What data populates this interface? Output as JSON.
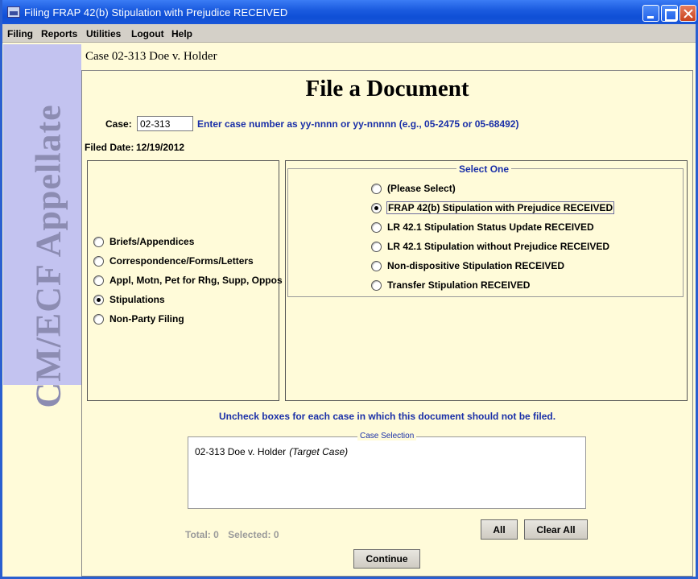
{
  "window": {
    "title": "Filing FRAP 42(b) Stipulation with Prejudice RECEIVED"
  },
  "menu": [
    "Filing",
    "Reports",
    "Utilities",
    "Logout",
    "Help"
  ],
  "sidebar": {
    "logo_text": "CM/ECF Appellate"
  },
  "case_header": "Case 02-313 Doe v. Holder",
  "page_title": "File a Document",
  "case_field": {
    "label": "Case:",
    "value": "02-313",
    "hint": "Enter case number as yy-nnnn or yy-nnnnn (e.g., 05-2475 or 05-68492)"
  },
  "filed_date": {
    "label": "Filed Date:",
    "value": "12/19/2012"
  },
  "categories": [
    {
      "label": "Briefs/Appendices",
      "checked": false
    },
    {
      "label": "Correspondence/Forms/Letters",
      "checked": false
    },
    {
      "label": "Appl, Motn, Pet for Rhg, Supp, Oppos",
      "checked": false
    },
    {
      "label": "Stipulations",
      "checked": true
    },
    {
      "label": "Non-Party Filing",
      "checked": false
    }
  ],
  "select_one": {
    "legend": "Select One",
    "options": [
      {
        "label": "(Please Select)",
        "checked": false
      },
      {
        "label": "FRAP 42(b) Stipulation with Prejudice RECEIVED",
        "checked": true
      },
      {
        "label": "LR 42.1 Stipulation Status Update RECEIVED",
        "checked": false
      },
      {
        "label": "LR 42.1 Stipulation without Prejudice RECEIVED",
        "checked": false
      },
      {
        "label": "Non-dispositive Stipulation RECEIVED",
        "checked": false
      },
      {
        "label": "Transfer Stipulation RECEIVED",
        "checked": false
      }
    ]
  },
  "uncheck_instruction": "Uncheck boxes for each case in which this document should not be filed.",
  "case_selection": {
    "legend": "Case Selection",
    "rows": [
      {
        "case": "02-313 Doe v. Holder",
        "note": "(Target Case)"
      }
    ]
  },
  "totals": {
    "total": "Total: 0",
    "selected": "Selected: 0"
  },
  "buttons": {
    "all": "All",
    "clear_all": "Clear All",
    "continue": "Continue"
  },
  "colors": {
    "accent_text": "#1a2fa8",
    "background": "#fffbd9",
    "sidebar": "#c3c3f0"
  }
}
